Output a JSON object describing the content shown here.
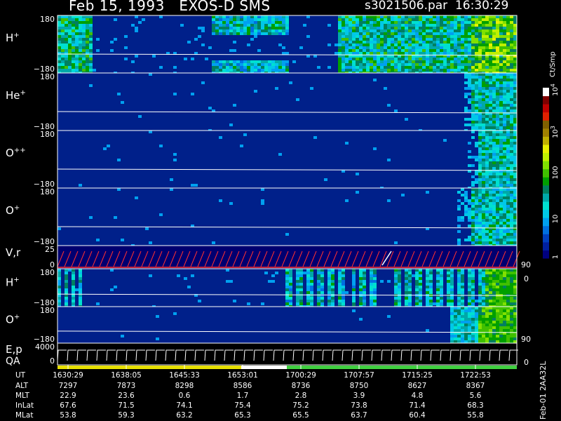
{
  "header": {
    "date": "Feb 15, 1993",
    "instrument": "EXOS-D SMS",
    "file": "s3021506.par",
    "time": "16:30:29"
  },
  "panels": [
    {
      "label": "H",
      "sup": "+",
      "ymax": "180",
      "ymin": "−180"
    },
    {
      "label": "He",
      "sup": "+",
      "ymax": "180",
      "ymin": "−180"
    },
    {
      "label": "O",
      "sup": "++",
      "ymax": "180",
      "ymin": "−180"
    },
    {
      "label": "O",
      "sup": "+",
      "ymax": "180",
      "ymin": "−180"
    },
    {
      "label": "V,r",
      "sup": "",
      "ymax": "25",
      "ymin": "0",
      "rmax": "90",
      "rmin": "0"
    },
    {
      "label": "H",
      "sup": "+",
      "ymax": "180",
      "ymin": "−180"
    },
    {
      "label": "O",
      "sup": "+",
      "ymax": "180",
      "ymin": "−180",
      "rmax": "90"
    },
    {
      "label": "E,p",
      "sup": "",
      "label2": "QA",
      "ymax": "4000",
      "ymin": "0",
      "rmin": "0"
    }
  ],
  "colorbar": {
    "unit": "Ct/Smp",
    "ticks": [
      "1",
      "10",
      "100",
      "10",
      "10"
    ],
    "tick_sups": [
      "",
      "",
      "",
      "3",
      "4"
    ],
    "colors": [
      "#000080",
      "#0020a0",
      "#0040c0",
      "#0070e0",
      "#00a0f0",
      "#00c8e8",
      "#00e0d0",
      "#00a8a8",
      "#008060",
      "#00a000",
      "#40c000",
      "#80e000",
      "#c0f000",
      "#e8f000",
      "#c0b000",
      "#a08000",
      "#806000",
      "#e02000",
      "#c00000",
      "#800000",
      "#ffffff"
    ]
  },
  "footer": {
    "labels": [
      "UT",
      "ALT",
      "MLT",
      "InLat",
      "MLat"
    ],
    "columns": [
      [
        "1630:29",
        "7297",
        "22.9",
        "67.6",
        "53.8"
      ],
      [
        "1638:05",
        "7873",
        "23.6",
        "71.5",
        "59.3"
      ],
      [
        "1645:33",
        "8298",
        "0.6",
        "74.1",
        "63.2"
      ],
      [
        "1653:01",
        "8586",
        "1.7",
        "75.4",
        "65.3"
      ],
      [
        "1700:29",
        "8736",
        "2.8",
        "75.2",
        "65.5"
      ],
      [
        "1707:57",
        "8750",
        "3.9",
        "73.8",
        "63.7"
      ],
      [
        "1715:25",
        "8627",
        "4.8",
        "71.4",
        "60.4"
      ],
      [
        "1722:53",
        "8367",
        "5.6",
        "68.3",
        "55.8"
      ]
    ],
    "side_id": "Feb-01  2AA32L"
  },
  "chart_data": {
    "type": "heatmap",
    "title": "Feb 15, 1993   EXOS-D SMS",
    "x_ticks": [
      "1630:29",
      "1638:05",
      "1645:33",
      "1653:01",
      "1700:29",
      "1707:57",
      "1715:25",
      "1722:53"
    ],
    "panels": [
      "H+",
      "He+",
      "O++",
      "O+",
      "V,r",
      "H+",
      "O+",
      "E,p / QA"
    ],
    "ylim": [
      -180,
      180
    ],
    "color_scale": "log",
    "color_range": [
      1,
      10000
    ],
    "color_unit": "Ct/Smp"
  }
}
